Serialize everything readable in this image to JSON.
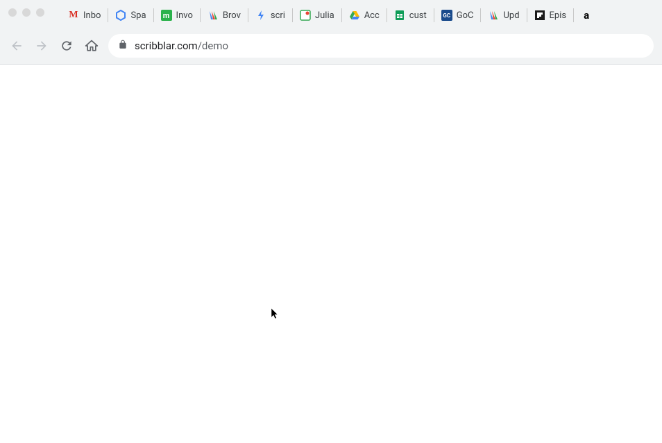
{
  "window": {
    "controls": [
      "close",
      "minimize",
      "maximize"
    ]
  },
  "bookmarks": [
    {
      "label": "Inbo",
      "icon": "gmail"
    },
    {
      "label": "Spa",
      "icon": "hexagon-blue"
    },
    {
      "label": "Invo",
      "icon": "m-green"
    },
    {
      "label": "Brov",
      "icon": "tri-color"
    },
    {
      "label": "scri",
      "icon": "blue-bolt"
    },
    {
      "label": "Julia",
      "icon": "julia"
    },
    {
      "label": "Acc",
      "icon": "gdrive"
    },
    {
      "label": "cust",
      "icon": "gsheets"
    },
    {
      "label": "GoC",
      "icon": "gc-badge"
    },
    {
      "label": "Upd",
      "icon": "tri-color"
    },
    {
      "label": "Epis",
      "icon": "flipboard"
    },
    {
      "label": "",
      "icon": "amazon"
    }
  ],
  "nav": {
    "back_enabled": false,
    "forward_enabled": false
  },
  "url": {
    "secure": true,
    "host": "scribblar.com",
    "path": "/demo"
  }
}
